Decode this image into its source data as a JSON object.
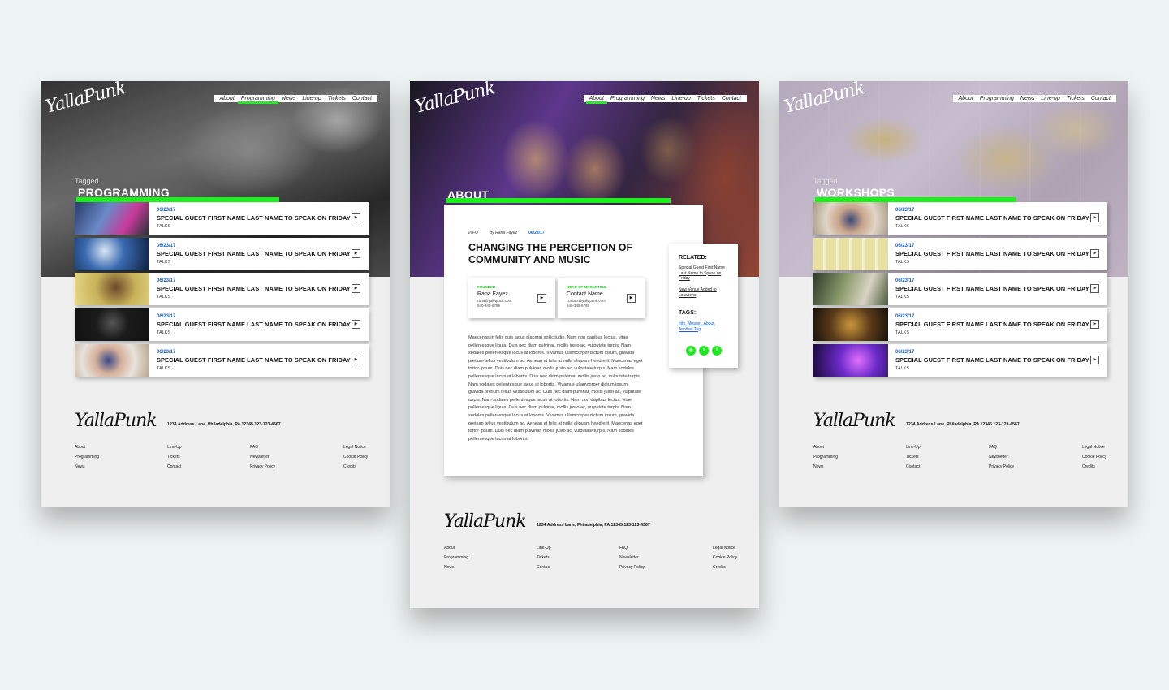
{
  "nav": [
    "About",
    "Programming",
    "News",
    "Line-up",
    "Tickets",
    "Contact"
  ],
  "logo": "YallaPunk",
  "pages": {
    "programming": {
      "tagged": "Tagged",
      "title": "PROGRAMMING",
      "active_nav": "Programming"
    },
    "about": {
      "title": "ABOUT",
      "active_nav": "About"
    },
    "workshops": {
      "tagged": "Tagged",
      "title": "WORKSHOPS",
      "active_nav": ""
    }
  },
  "list_items": [
    {
      "date": "06/23/17",
      "title": "SPECIAL GUEST FIRST NAME LAST NAME TO SPEAK ON FRIDAY",
      "category": "TALKS"
    },
    {
      "date": "06/23/17",
      "title": "SPECIAL GUEST FIRST NAME LAST NAME TO SPEAK ON FRIDAY",
      "category": "TALKS"
    },
    {
      "date": "06/23/17",
      "title": "SPECIAL GUEST FIRST NAME LAST NAME TO SPEAK ON FRIDAY",
      "category": "TALKS"
    },
    {
      "date": "06/23/17",
      "title": "SPECIAL GUEST FIRST NAME LAST NAME TO SPEAK ON FRIDAY",
      "category": "TALKS"
    },
    {
      "date": "06/23/17",
      "title": "SPECIAL GUEST FIRST NAME LAST NAME TO SPEAK ON FRIDAY",
      "category": "TALKS"
    }
  ],
  "article": {
    "meta_section": "INFO",
    "meta_author": "By Rana Fayez",
    "meta_date": "06/23/17",
    "title": "CHANGING THE PERCEPTION OF COMMUNITY AND MUSIC",
    "contacts": [
      {
        "role": "FOUNDER",
        "name": "Rana Fayez",
        "email": "rana@yallapunk.com",
        "phone": "540-345-6789"
      },
      {
        "role": "HEAD OF MARKETING",
        "name": "Contact Name",
        "email": "contact@yallapunk.com",
        "phone": "540-345-6789"
      }
    ],
    "body": "Maecenas in felis quis lacus placerat sollicitudin. Nam non dapibus lectus, vitae pellentesque ligula. Duis nec diam pulvinar, mollis justo ac, vulputate turpis. Nam sodales pellentesque lacus at lobortis. Vivamus ullamcorper dictum ipsum, gravida pretium tellus vestibulum ac. Aenean et felis at nulla aliquam hendrerit. Maecenas eget tortor ipsum. Duis nec diam pulvinar, mollis justo ac, vulputate turpis. Nam sodales pellentesque lacus at lobortis. Duis nec diam pulvinar, mollis justo ac, vulputate turpis. Nam sodales pellentesque lacus at lobortis. Vivamus ullamcorper dictum ipsum, gravida pretium tellus vestibulum ac. Duis nec diam pulvinar, mollis justo ac, vulputate turpis. Nam sodales pellentesque lacus at lobortis. Nam non dapibus lectus, vitae pellentesque ligula. Duis nec diam pulvinar, mollis justo ac, vulputate turpis. Nam sodales pellentesque lacus at lobortis. Vivamus ullamcorper dictum ipsum, gravida pretium tellus vestibulum ac. Aenean et felis at nulla aliquam hendrerit. Maecenas eget tortor ipsum. Duis nec diam pulvinar, mollis justo ac, vulputate turpis. Nam sodales pellentesque lacus at lobortis."
  },
  "related": {
    "heading": "RELATED:",
    "links": [
      "Special Guest First Name Last Name to Speak on Friday",
      "New Venue Added to Locations"
    ],
    "tags_heading": "TAGS:",
    "tags": "Info, Mission, About, Another Tag"
  },
  "footer": {
    "address": "1234 Address Lane, Philadelphia, PA 12345     123-123-4567",
    "col1": [
      "About",
      "Programming",
      "News"
    ],
    "col2": [
      "Line-Up",
      "Tickets",
      "Contact"
    ],
    "col3": [
      "FAQ",
      "Newsletter",
      "Privacy Policy"
    ],
    "col4": [
      "Legal Notice",
      "Cookie Policy",
      "Credits"
    ]
  },
  "colors": {
    "accent_green": "#1ef01e",
    "date_blue": "#1a5fc8",
    "background": "#eef4f3"
  }
}
